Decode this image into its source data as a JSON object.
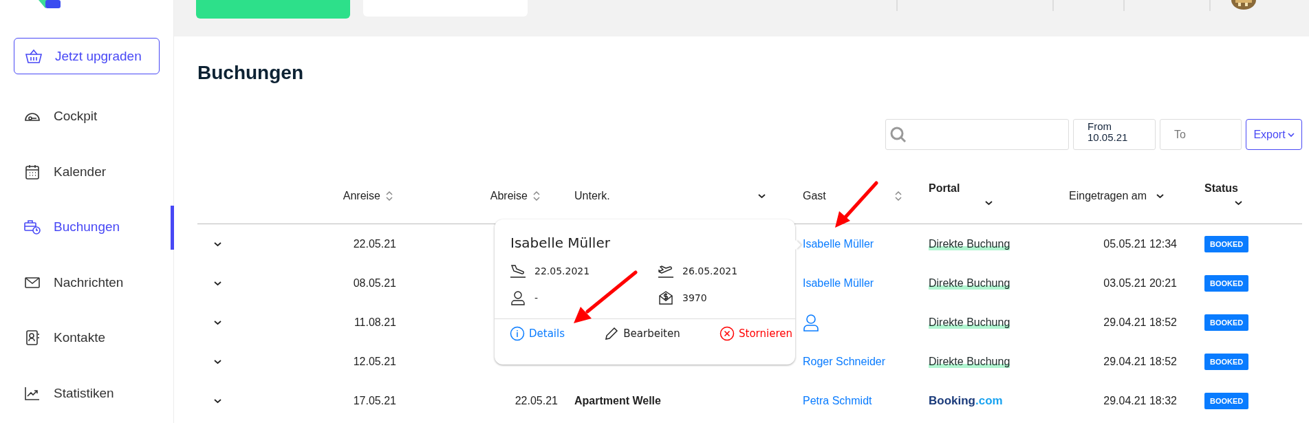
{
  "upgrade_button": {
    "label": "Jetzt upgraden"
  },
  "sidebar": {
    "items": [
      {
        "label": "Cockpit",
        "selected": false
      },
      {
        "label": "Kalender",
        "selected": false
      },
      {
        "label": "Buchungen",
        "selected": true
      },
      {
        "label": "Nachrichten",
        "selected": false
      },
      {
        "label": "Kontakte",
        "selected": false
      },
      {
        "label": "Statistiken",
        "selected": false
      }
    ]
  },
  "page_title": "Buchungen",
  "filters": {
    "date_from": {
      "label": "From",
      "value": "10.05.21"
    },
    "date_to": {
      "placeholder": "To"
    },
    "export_button": {
      "label": "Export"
    }
  },
  "table": {
    "columns": [
      {
        "label": "Anreise",
        "kind": "sort"
      },
      {
        "label": "Abreise",
        "kind": "sort"
      },
      {
        "label": "Unterk.",
        "kind": "dropdown"
      },
      {
        "label": "Gast",
        "kind": "sort"
      },
      {
        "label": "Portal",
        "kind": "dropdown_below"
      },
      {
        "label": "Eingetragen am",
        "kind": "dropdown"
      },
      {
        "label": "Status",
        "kind": "dropdown_below"
      }
    ],
    "rows": [
      {
        "anreise": "22.05.21",
        "gast": {
          "kind": "name",
          "text": "Isabelle Müller"
        },
        "portal": {
          "kind": "direct",
          "text": "Direkte Buchung"
        },
        "eingetragen": "05.05.21 12:34",
        "status": "BOOKED"
      },
      {
        "anreise": "08.05.21",
        "gast": {
          "kind": "name",
          "text": "Isabelle Müller"
        },
        "portal": {
          "kind": "direct",
          "text": "Direkte Buchung"
        },
        "eingetragen": "03.05.21 20:21",
        "status": "BOOKED"
      },
      {
        "anreise": "11.08.21",
        "gast": {
          "kind": "unknown"
        },
        "portal": {
          "kind": "direct",
          "text": "Direkte Buchung"
        },
        "eingetragen": "29.04.21 18:52",
        "status": "BOOKED"
      },
      {
        "anreise": "12.05.21",
        "gast": {
          "kind": "name",
          "text": "Roger Schneider"
        },
        "portal": {
          "kind": "direct",
          "text": "Direkte Buchung"
        },
        "eingetragen": "29.04.21 18:52",
        "status": "BOOKED"
      },
      {
        "anreise": "17.05.21",
        "abreise": "22.05.21",
        "unterkunft": "Apartment Welle",
        "gast": {
          "kind": "name",
          "text": "Petra Schmidt"
        },
        "portal": {
          "kind": "logo",
          "text": "Booking",
          "suffix": ".com"
        },
        "eingetragen": "29.04.21 18:32",
        "status": "BOOKED"
      }
    ]
  },
  "popover": {
    "title": "Isabelle Müller",
    "arrival": "22.05.2021",
    "departure": "26.05.2021",
    "guests": "-",
    "price": "3970",
    "actions": [
      {
        "kind": "details",
        "label": "Details"
      },
      {
        "kind": "edit",
        "label": "Bearbeiten"
      },
      {
        "kind": "cancel",
        "label": "Stornieren"
      }
    ]
  }
}
